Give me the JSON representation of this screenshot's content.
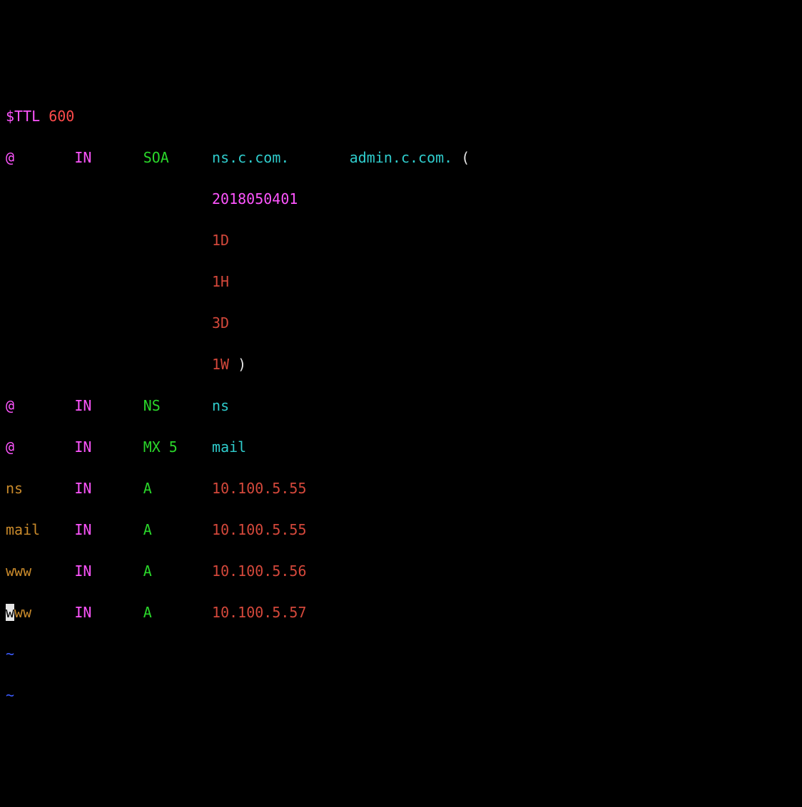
{
  "ttl": {
    "directive": "$TTL",
    "value": "600"
  },
  "soa": {
    "origin": "@",
    "class": "IN",
    "type": "SOA",
    "ns": "ns.c.com.",
    "admin": "admin.c.com.",
    "open": "(",
    "serial": "2018050401",
    "refresh": "1D",
    "retry": "1H",
    "expire": "3D",
    "minimum": "1W",
    "close": ")"
  },
  "records": [
    {
      "name": "@",
      "class": "IN",
      "type": "NS",
      "value": "ns"
    },
    {
      "name": "@",
      "class": "IN",
      "type": "MX 5",
      "value": "mail"
    },
    {
      "name": "ns",
      "class": "IN",
      "type": "A",
      "value": "10.100.5.55"
    },
    {
      "name": "mail",
      "class": "IN",
      "type": "A",
      "value": "10.100.5.55"
    },
    {
      "name": "www",
      "class": "IN",
      "type": "A",
      "value": "10.100.5.56"
    },
    {
      "name": "www",
      "class": "IN",
      "type": "A",
      "value": "10.100.5.57"
    }
  ],
  "tilde": "~"
}
